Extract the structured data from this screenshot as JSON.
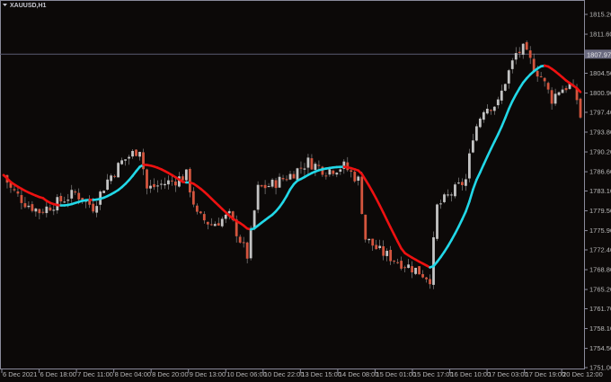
{
  "symbol_title": "XAUUSD,H1",
  "colors": {
    "background": "#0c0908",
    "bull": "#c4c4c4",
    "bear": "#d4553e",
    "ma_up": "#22d8e8",
    "ma_down": "#ee1111",
    "axis": "#8a8a9a",
    "price_line": "#5a5a70"
  },
  "chart_data": {
    "type": "candlestick",
    "title": "XAUUSD,H1",
    "ylim": [
      1751.0,
      1815.2
    ],
    "y_ticks": [
      "1815.20",
      "1811.60",
      "1804.50",
      "1800.90",
      "1797.40",
      "1793.80",
      "1790.20",
      "1786.60",
      "1783.10",
      "1779.50",
      "1775.90",
      "1772.40",
      "1768.80",
      "1765.20",
      "1761.70",
      "1758.10",
      "1754.50",
      "1751.00"
    ],
    "y_tick_values": [
      1815.2,
      1811.6,
      1804.5,
      1800.9,
      1797.4,
      1793.8,
      1790.2,
      1786.6,
      1783.1,
      1779.5,
      1775.9,
      1772.4,
      1768.8,
      1765.2,
      1761.7,
      1758.1,
      1754.5,
      1751.0
    ],
    "current_price": "1807.97",
    "x_ticks": [
      "6 Dec 2021",
      "6 Dec 18:00",
      "7 Dec 11:00",
      "8 Dec 04:00",
      "8 Dec 20:00",
      "9 Dec 13:00",
      "10 Dec 06:00",
      "10 Dec 22:00",
      "13 Dec 15:00",
      "14 Dec 08:00",
      "15 Dec 01:00",
      "15 Dec 17:00",
      "16 Dec 10:00",
      "17 Dec 03:00",
      "17 Dec 19:00",
      "20 Dec 12:00"
    ],
    "bar_count": 162,
    "close_anchors": [
      [
        0,
        1786.0
      ],
      [
        2,
        1783.5
      ],
      [
        6,
        1781.0
      ],
      [
        10,
        1779.4
      ],
      [
        15,
        1781.0
      ],
      [
        20,
        1782.7
      ],
      [
        25,
        1780.2
      ],
      [
        29,
        1785.1
      ],
      [
        33,
        1788.4
      ],
      [
        38,
        1790.9
      ],
      [
        40,
        1783.5
      ],
      [
        44,
        1784.3
      ],
      [
        48,
        1785.1
      ],
      [
        51,
        1786.0
      ],
      [
        54,
        1778.6
      ],
      [
        58,
        1777.0
      ],
      [
        63,
        1778.6
      ],
      [
        68,
        1771.3
      ],
      [
        71,
        1783.5
      ],
      [
        75,
        1784.3
      ],
      [
        80,
        1786.0
      ],
      [
        85,
        1788.4
      ],
      [
        90,
        1786.8
      ],
      [
        95,
        1787.6
      ],
      [
        99,
        1785.1
      ],
      [
        101,
        1774.5
      ],
      [
        105,
        1772.1
      ],
      [
        110,
        1770.4
      ],
      [
        115,
        1768.8
      ],
      [
        119,
        1767.2
      ],
      [
        121,
        1780.2
      ],
      [
        125,
        1782.7
      ],
      [
        129,
        1785.1
      ],
      [
        131,
        1793.3
      ],
      [
        134,
        1798.2
      ],
      [
        138,
        1799.0
      ],
      [
        140,
        1803.1
      ],
      [
        143,
        1808.0
      ],
      [
        145,
        1808.8
      ],
      [
        148,
        1805.6
      ],
      [
        150,
        1803.9
      ],
      [
        153,
        1799.8
      ],
      [
        155,
        1801.5
      ],
      [
        158,
        1802.3
      ],
      [
        160,
        1799.8
      ],
      [
        161,
        1796.6
      ]
    ],
    "indicator": {
      "name": "moving average",
      "period": 12
    }
  }
}
